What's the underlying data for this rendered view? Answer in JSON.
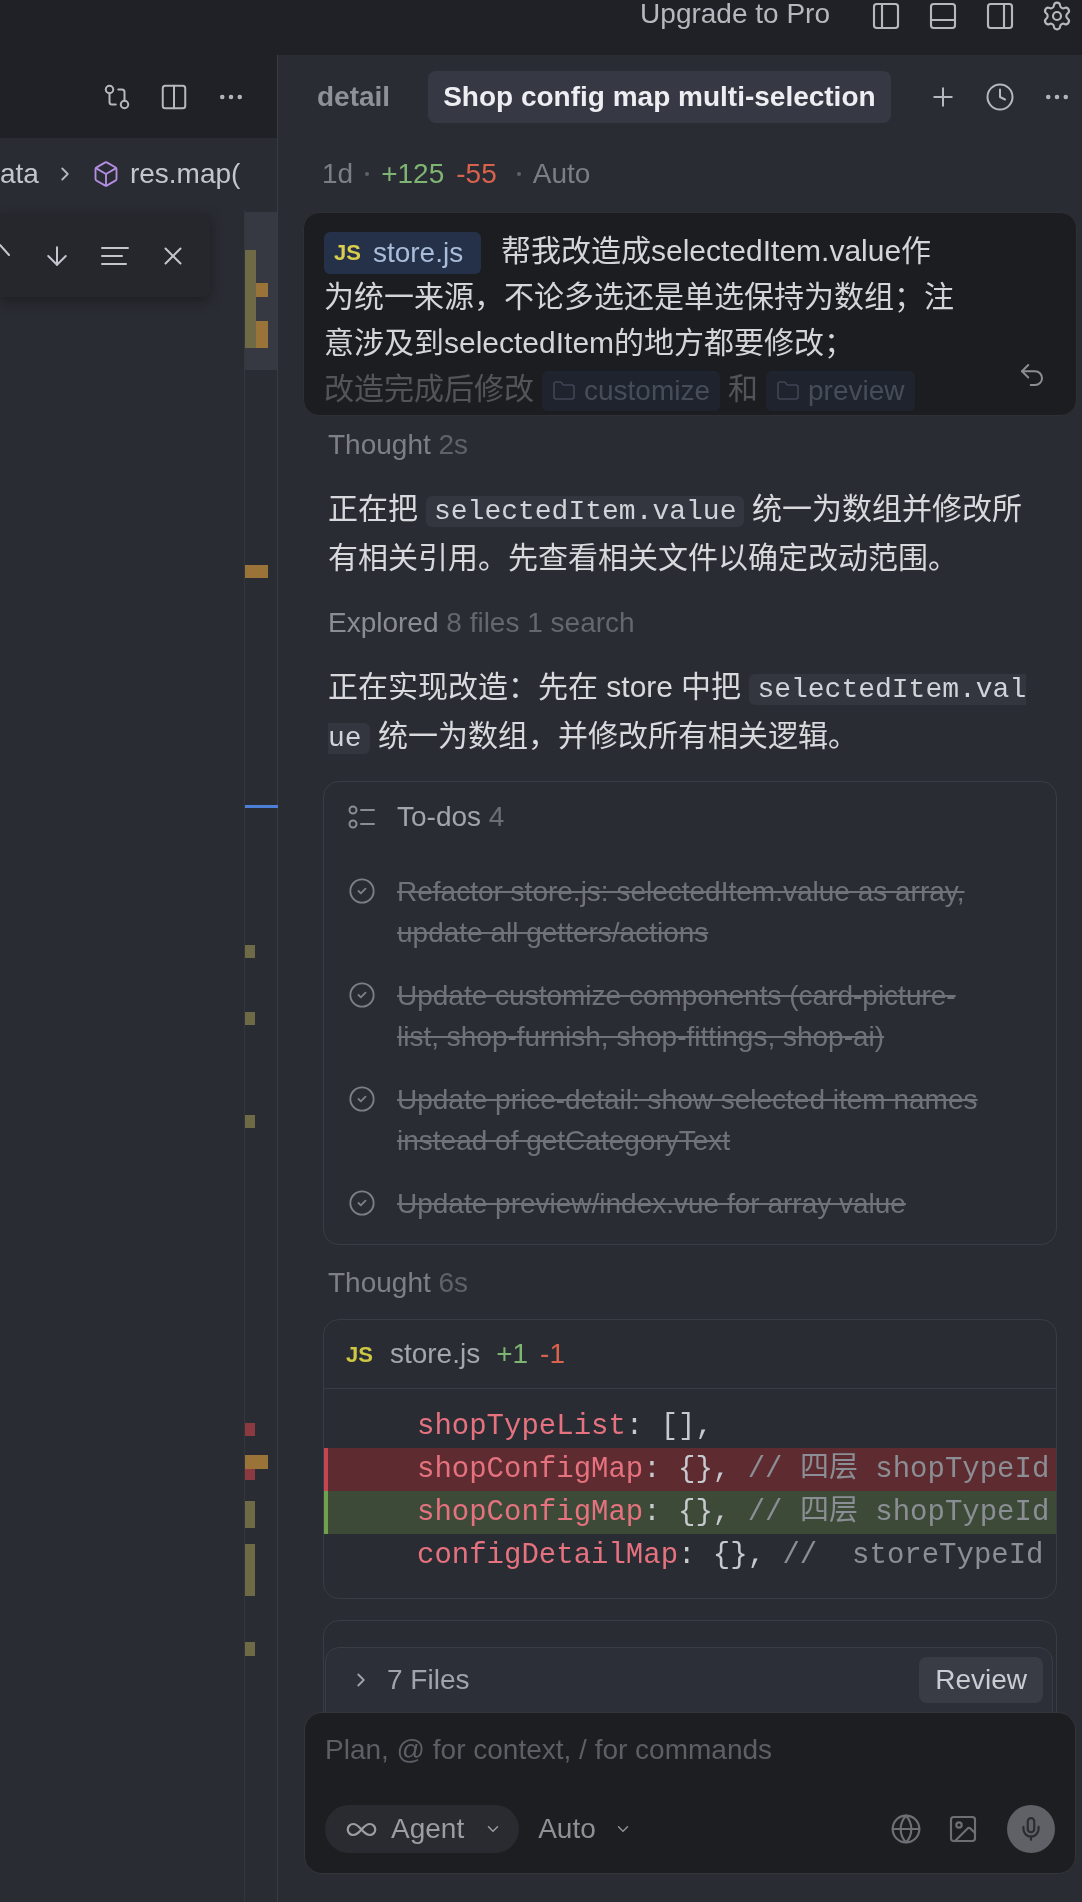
{
  "top_bar": {
    "upgrade": "Upgrade to Pro"
  },
  "editor": {
    "breadcrumb": [
      {
        "kind": "text",
        "label": "ata"
      },
      {
        "kind": "symbol",
        "label": "res.map("
      }
    ]
  },
  "chat": {
    "tabs": [
      {
        "label": "detail",
        "selected": false
      },
      {
        "label": "Shop config map multi-selection",
        "selected": true
      }
    ],
    "meta": {
      "age": "1d",
      "additions": "+125",
      "deletions": "-55",
      "mode": "Auto"
    },
    "user_message": {
      "parts": [
        {
          "kind": "file",
          "badge": "JS",
          "label": "store.js"
        },
        {
          "kind": "text",
          "text": "帮我改造成selectedItem.value作为统一来源，不论多选还是单选保持为数组；注意涉及到selectedItem的地方都要修改；"
        },
        {
          "kind": "break"
        },
        {
          "kind": "text",
          "text": "改造完成后修改"
        },
        {
          "kind": "folder",
          "label": "customize"
        },
        {
          "kind": "text",
          "text": "和"
        },
        {
          "kind": "folder",
          "label": "preview"
        }
      ]
    },
    "timeline": [
      {
        "kind": "thought",
        "label": "Thought",
        "duration": "2s"
      },
      {
        "kind": "paragraph",
        "parts": [
          {
            "kind": "text",
            "text": "正在把"
          },
          {
            "kind": "code",
            "text": "selectedItem.value"
          },
          {
            "kind": "text",
            "text": "统一为数组并修改所有相关引用。先查看相关文件以确定改动范围。"
          }
        ]
      },
      {
        "kind": "explored",
        "label": "Explored",
        "detail": "8 files 1 search"
      },
      {
        "kind": "paragraph",
        "parts": [
          {
            "kind": "text",
            "text": "正在实现改造：先在 store 中把"
          },
          {
            "kind": "code",
            "text": "selectedItem.value"
          },
          {
            "kind": "text",
            "text": "统一为数组，并修改所有相关逻辑。"
          }
        ]
      },
      {
        "kind": "todos",
        "title": "To-dos",
        "count": "4",
        "items": [
          {
            "text": "Refactor store.js: selectedItem.value as array, update all getters/actions",
            "done": true
          },
          {
            "text": "Update customize components (card-picture-list, shop-furnish, shop-fittings, shop-ai)",
            "done": true
          },
          {
            "text": "Update price-detail: show selected item names instead of getCategoryText",
            "done": true
          },
          {
            "text": "Update preview/index.vue for array value",
            "done": true
          }
        ]
      },
      {
        "kind": "thought",
        "label": "Thought",
        "duration": "6s"
      },
      {
        "kind": "diff",
        "badge": "JS",
        "file": "store.js",
        "additions": "+1",
        "deletions": "-1",
        "lines": [
          {
            "kind": "context",
            "tokens": [
              {
                "kind": "property",
                "text": "shopTypeList"
              },
              {
                "kind": "punctuation",
                "text": ": [],"
              }
            ]
          },
          {
            "kind": "removed",
            "tokens": [
              {
                "kind": "property",
                "text": "shopConfigMap"
              },
              {
                "kind": "punctuation",
                "text": ": {}, "
              },
              {
                "kind": "comment",
                "text": "// 四层 shopTypeId"
              }
            ]
          },
          {
            "kind": "added",
            "tokens": [
              {
                "kind": "property",
                "text": "shopConfigMap"
              },
              {
                "kind": "punctuation",
                "text": ": {}, "
              },
              {
                "kind": "comment",
                "text": "// 四层 shopTypeId"
              }
            ]
          },
          {
            "kind": "context",
            "tokens": [
              {
                "kind": "property",
                "text": "configDetailMap"
              },
              {
                "kind": "punctuation",
                "text": ": {}, "
              },
              {
                "kind": "comment",
                "text": "//  storeTypeId"
              }
            ]
          }
        ]
      }
    ]
  },
  "composer": {
    "files": {
      "label": "7 Files",
      "expanded": false,
      "action": "Review"
    },
    "placeholder": "Plan, @ for context, / for commands",
    "agent": "Agent",
    "model": "Auto"
  }
}
